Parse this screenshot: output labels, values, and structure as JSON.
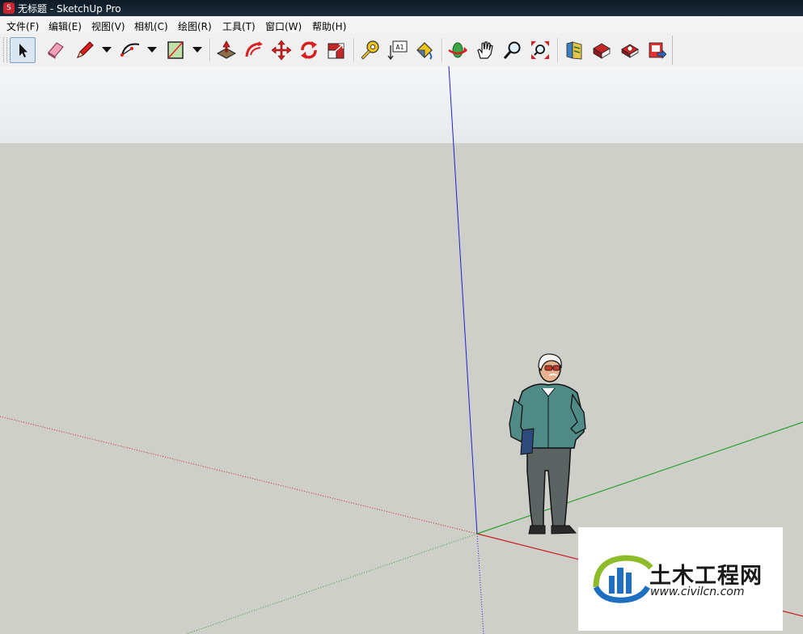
{
  "window": {
    "title": "无标题 - SketchUp Pro"
  },
  "menu": {
    "file": "文件(F)",
    "edit": "编辑(E)",
    "view": "视图(V)",
    "camera": "相机(C)",
    "draw": "绘图(R)",
    "tools": "工具(T)",
    "window": "窗口(W)",
    "help": "帮助(H)"
  },
  "toolbar": {
    "active_tool": "select",
    "tools": [
      {
        "name": "select",
        "icon": "arrow-cursor-icon"
      },
      {
        "name": "eraser",
        "icon": "eraser-icon"
      },
      {
        "name": "pencil",
        "icon": "pencil-icon"
      },
      {
        "name": "arc",
        "icon": "arc-icon"
      },
      {
        "name": "rectangle",
        "icon": "rectangle-icon"
      },
      {
        "name": "push-pull",
        "icon": "push-pull-icon"
      },
      {
        "name": "follow-me",
        "icon": "follow-me-icon"
      },
      {
        "name": "move",
        "icon": "move-icon"
      },
      {
        "name": "rotate",
        "icon": "rotate-icon"
      },
      {
        "name": "scale",
        "icon": "scale-icon"
      },
      {
        "name": "tape-measure",
        "icon": "tape-measure-icon"
      },
      {
        "name": "text",
        "icon": "text-icon"
      },
      {
        "name": "paint-bucket",
        "icon": "paint-bucket-icon"
      },
      {
        "name": "orbit",
        "icon": "orbit-icon"
      },
      {
        "name": "pan",
        "icon": "pan-hand-icon"
      },
      {
        "name": "zoom",
        "icon": "zoom-icon"
      },
      {
        "name": "zoom-extents",
        "icon": "zoom-extents-icon"
      },
      {
        "name": "3d-warehouse",
        "icon": "warehouse-icon"
      },
      {
        "name": "get-models",
        "icon": "get-models-icon"
      },
      {
        "name": "share-model",
        "icon": "share-model-icon"
      },
      {
        "name": "extension-warehouse",
        "icon": "extension-warehouse-icon"
      }
    ],
    "text_tool_label": "A1"
  },
  "colors": {
    "axis_red": "#c81e1e",
    "axis_green": "#2aa12a",
    "axis_blue": "#2020c8",
    "ground": "#cfcfca",
    "sky": "#eef0f2"
  },
  "watermark": {
    "title": "土木工程网",
    "url": "www.civilcn.com"
  }
}
